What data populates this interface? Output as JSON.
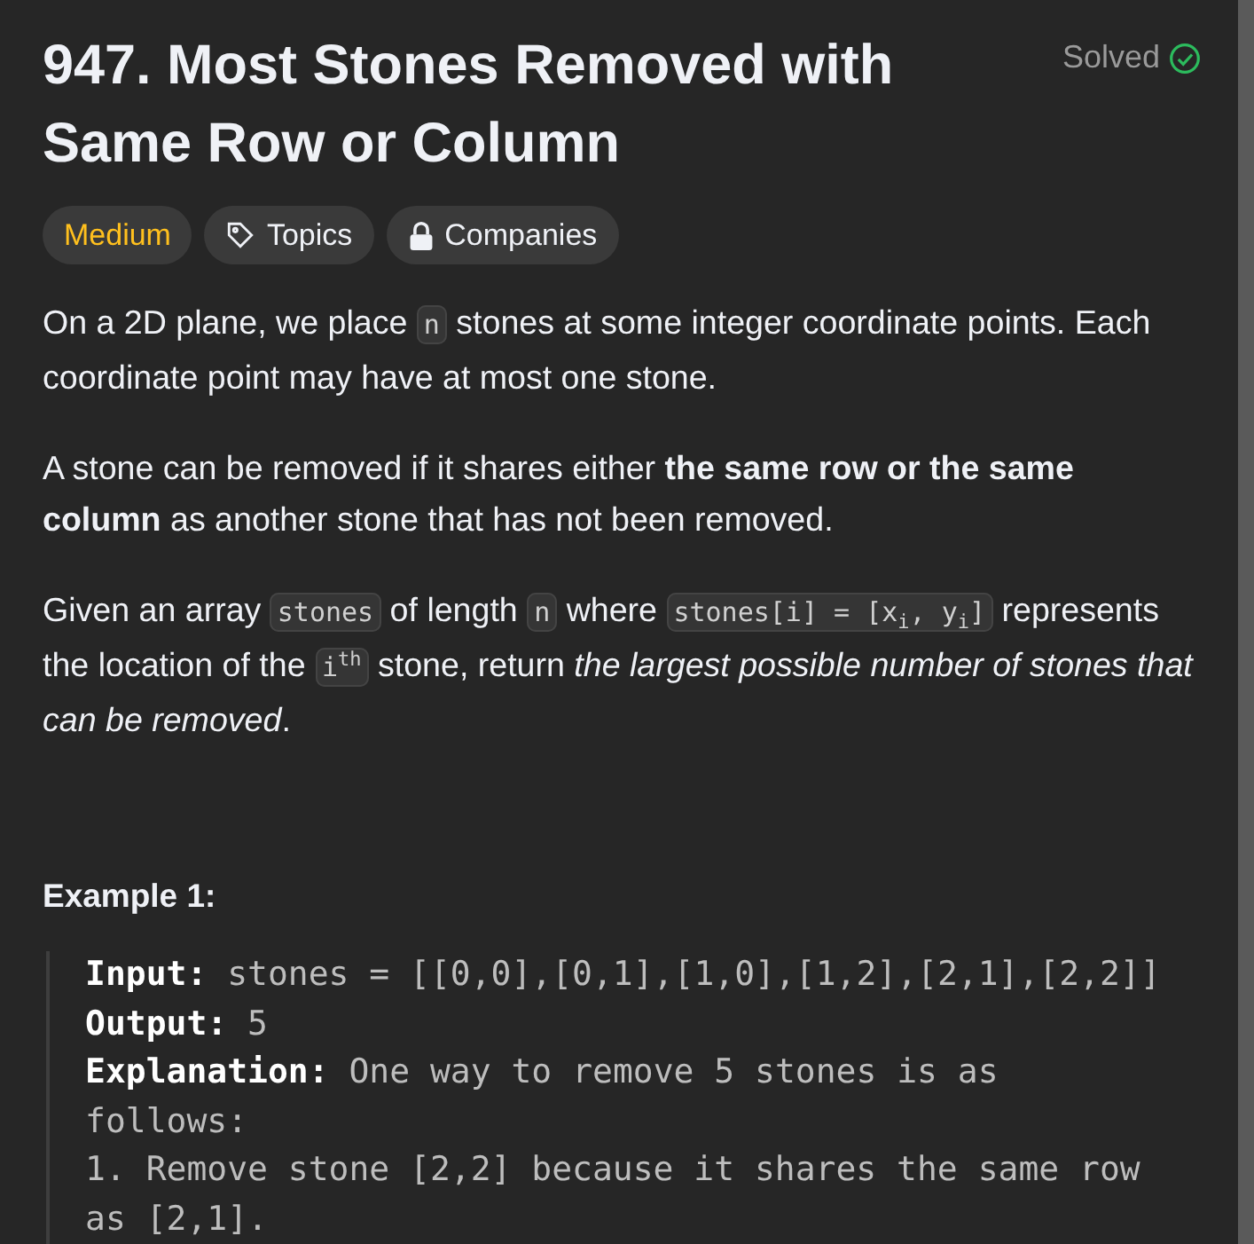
{
  "title": "947. Most Stones Removed with Same Row or Column",
  "status": {
    "label": "Solved",
    "solved": true
  },
  "tags": [
    {
      "kind": "difficulty",
      "label": "Medium"
    },
    {
      "kind": "topics",
      "label": "Topics"
    },
    {
      "kind": "companies",
      "label": "Companies"
    }
  ],
  "paragraphs": [
    [
      {
        "kind": "text",
        "text": "On a 2D plane, we place "
      },
      {
        "kind": "code",
        "text": "n"
      },
      {
        "kind": "text",
        "text": " stones at some integer coordinate points. Each coordinate point may have at most one stone."
      }
    ],
    [
      {
        "kind": "text",
        "text": "A stone can be removed if it shares either **the same row or the same column** as another stone that has not been removed."
      }
    ],
    [
      {
        "kind": "text",
        "text": "Given an array "
      },
      {
        "kind": "code",
        "text": "stones"
      },
      {
        "kind": "text",
        "text": " of length "
      },
      {
        "kind": "code",
        "text": "n"
      },
      {
        "kind": "text",
        "text": " where "
      },
      {
        "kind": "code",
        "text": "stones[i] = [x$_{i}$, y$_{i}$]"
      },
      {
        "kind": "text",
        "text": " represents the location of the "
      },
      {
        "kind": "code",
        "text": "i$^{th}$"
      },
      {
        "kind": "text",
        "text": " stone, return *the largest possible number of stones that can be removed*."
      }
    ]
  ],
  "example": {
    "heading": "Example 1:",
    "lines": [
      {
        "label": "Input:",
        "value": "stones = [[0,0],[0,1],[1,0],[1,2],[2,1],[2,2]]"
      },
      {
        "label": "Output:",
        "value": "5"
      },
      {
        "label": "Explanation:",
        "value": "One way to remove 5 stones is as follows:"
      },
      {
        "value": "1. Remove stone [2,2] because it shares the same row as [2,1]."
      }
    ]
  }
}
